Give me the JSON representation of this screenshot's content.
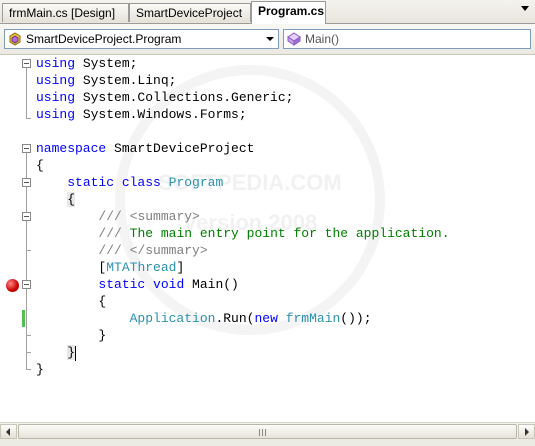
{
  "tabs": [
    {
      "label": "frmMain.cs [Design]",
      "active": false
    },
    {
      "label": "SmartDeviceProject",
      "active": false
    },
    {
      "label": "Program.cs",
      "active": true
    }
  ],
  "navbar": {
    "class_combo": "SmartDeviceProject.Program",
    "member_combo": "Main()"
  },
  "watermark": {
    "line1": "SOFTPEDIA.COM",
    "line2": "Version 2008"
  },
  "code": {
    "l1": {
      "kw": "using",
      "rest": " System;"
    },
    "l2": {
      "kw": "using",
      "rest": " System.Linq;"
    },
    "l3": {
      "kw": "using",
      "rest": " System.Collections.Generic;"
    },
    "l4": {
      "kw": "using",
      "rest": " System.Windows.Forms;"
    },
    "l6": {
      "kw": "namespace",
      "rest": " SmartDeviceProject"
    },
    "l7": "{",
    "l8": {
      "indent": "    ",
      "kw1": "static",
      "kw2": " class",
      "type": " Program"
    },
    "l9": {
      "indent": "    ",
      "text": "{"
    },
    "l10": {
      "indent": "        ",
      "xd1": "/// ",
      "xd2": "<summary>"
    },
    "l11": {
      "indent": "        ",
      "xd1": "/// ",
      "cm": "The main entry point for the application."
    },
    "l12": {
      "indent": "        ",
      "xd1": "/// ",
      "xd2": "</summary>"
    },
    "l13": {
      "indent": "        ",
      "open": "[",
      "type": "MTAThread",
      "close": "]"
    },
    "l14": {
      "indent": "        ",
      "kw1": "static",
      "kw2": " void",
      "rest": " Main()"
    },
    "l15": {
      "indent": "        ",
      "text": "{"
    },
    "l16": {
      "indent": "            ",
      "type": "Application",
      "mid": ".Run(",
      "kw": "new",
      "sp": " ",
      "type2": "frmMain",
      "end": "());"
    },
    "l17": {
      "indent": "        ",
      "text": "}"
    },
    "l18": {
      "indent": "    ",
      "text": "}"
    },
    "l19": "}"
  },
  "colors": {
    "keyword": "#0000ff",
    "type": "#2b91af",
    "comment": "#008000",
    "xmldoc": "#808080",
    "breakpoint": "#cc0000",
    "changebar": "#51c151"
  }
}
